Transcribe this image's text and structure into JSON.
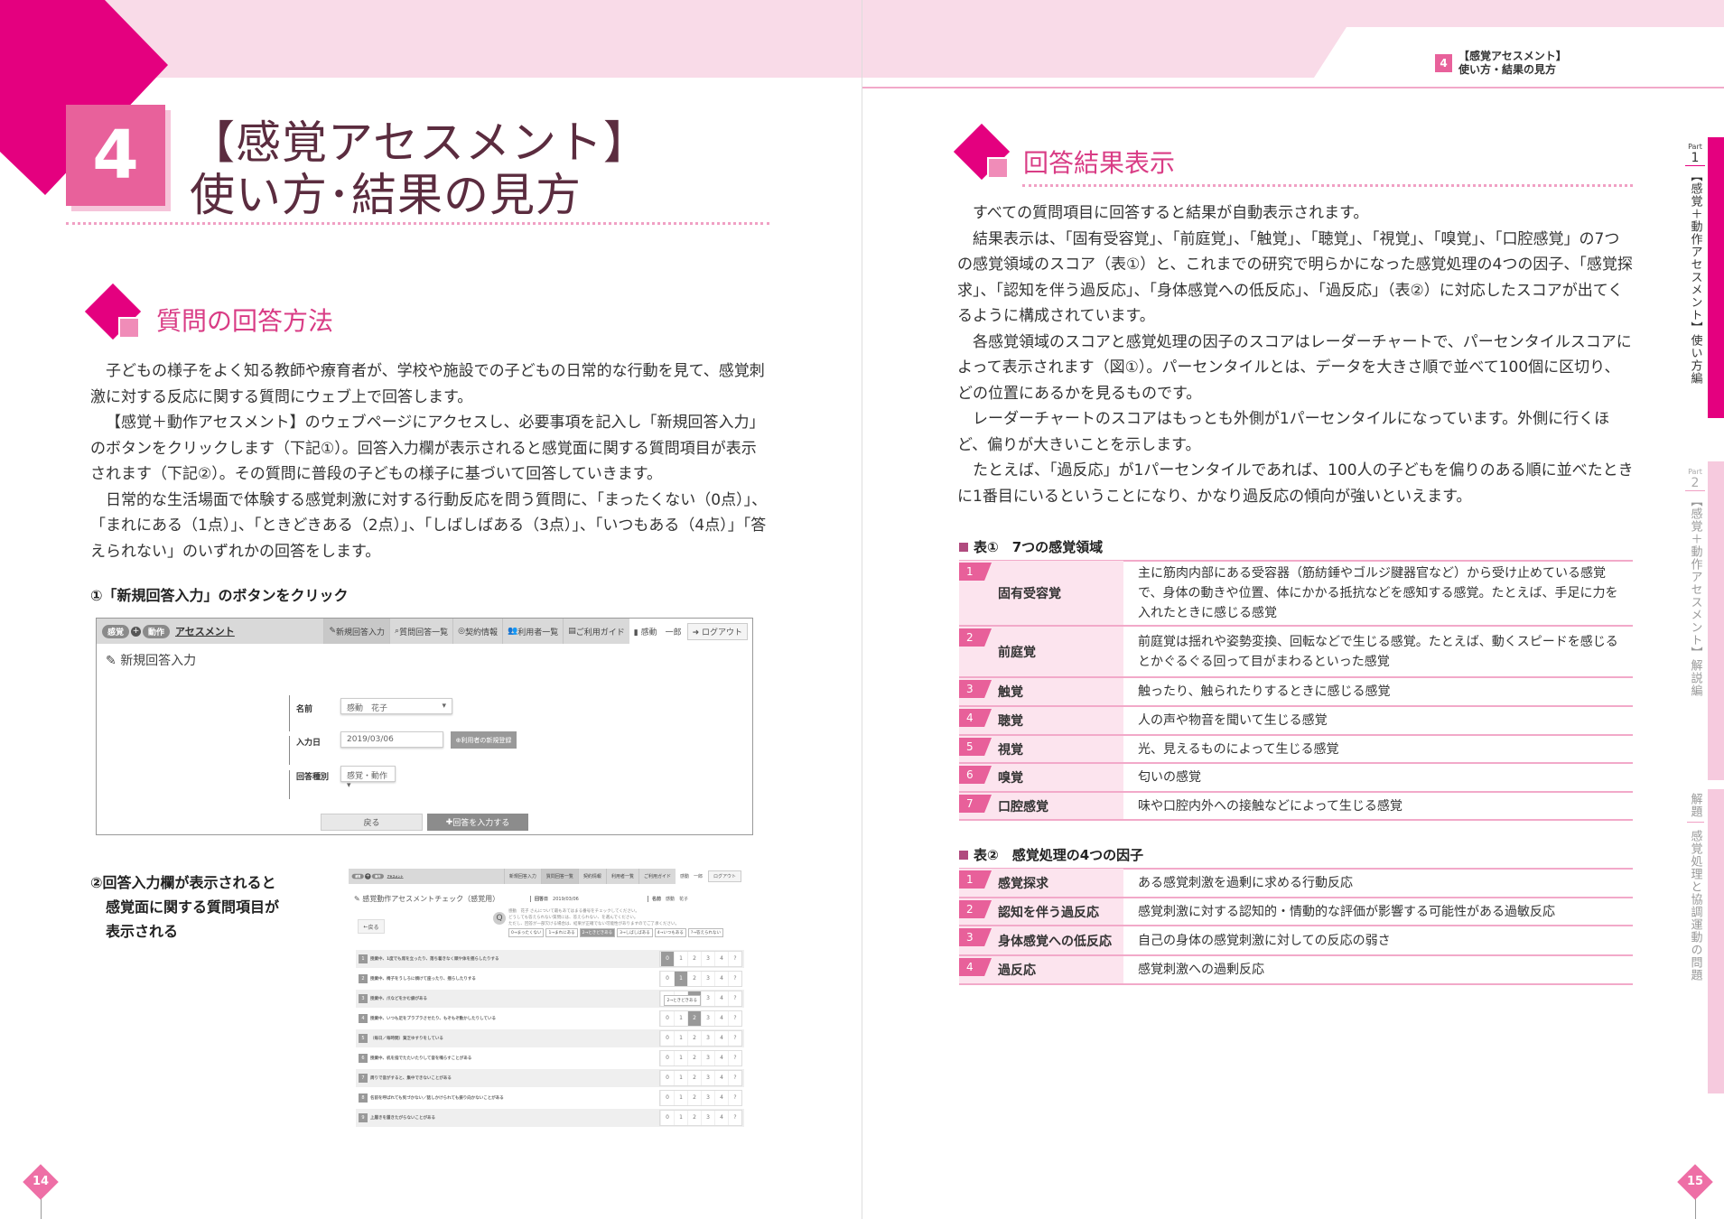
{
  "colors": {
    "accent": "#e4007f",
    "pink": "#e8619b",
    "band": "#f9dbe8",
    "title": "#5b2c3f"
  },
  "running_header": {
    "chapter_num": "4",
    "line1": "【感覚アセスメント】",
    "line2": "使い方・結果の見方"
  },
  "left": {
    "chapter_num": "4",
    "title_line1": "【感覚アセスメント】",
    "title_line2": "使い方･結果の見方",
    "section_title": "質問の回答方法",
    "paragraphs": [
      "子どもの様子をよく知る教師や療育者が、学校や施設での子どもの日常的な行動を見て、感覚刺激に対する反応に関する質問にウェブ上で回答します。",
      "【感覚＋動作アセスメント】のウェブページにアクセスし、必要事項を記入し「新規回答入力」のボタンをクリックします（下記①）。回答入力欄が表示されると感覚面に関する質問項目が表示されます（下記②）。その質問に普段の子どもの様子に基づいて回答していきます。",
      "日常的な生活場面で体験する感覚刺激に対する行動反応を問う質問に、「まったくない（0点）」、「まれにある（1点）」、「ときどきある（2点）」、「しばしばある（3点）」、「いつもある（4点）」「答えられない」のいずれかの回答をします。"
    ],
    "step1_label": "①「新規回答入力」のボタンをクリック",
    "step2_label": [
      "②回答入力欄が表示されると",
      "感覚面に関する質問項目が",
      "表示される"
    ],
    "page_number": "14"
  },
  "app": {
    "logo_sense": "感覚",
    "logo_plus": "+",
    "logo_motion": "動作",
    "logo_title": "アセスメント",
    "nav": [
      "新規回答入力",
      "質問回答一覧",
      "契約情報",
      "利用者一覧",
      "ご利用ガイド"
    ],
    "user": "感動　一郎",
    "logout": "ログアウト"
  },
  "screenshot1": {
    "page_title": "新規回答入力",
    "name_label": "名前",
    "name_value": "感動　花子",
    "date_label": "入力日",
    "date_value": "2019/03/06",
    "register_button": "利用者の新規登録",
    "type_label": "回答種別",
    "type_value": "感覚・動作",
    "back_button": "戻る",
    "submit_button": "回答を入力する"
  },
  "screenshot2": {
    "page_title": "感覚動作アセスメントチェック（感覚用）",
    "date_label": "回答日",
    "date_value": "2019/03/06",
    "name_label": "名前",
    "name_value": "感動　花子",
    "back_button": "戻る",
    "q_icon": "Q",
    "instructions": [
      "感動　花子 さんについて最もあてはまる番号をチェックしてください。",
      "どうしても答えられない質問には、答えられない、を選んでください。",
      "ただし、回答が一部欠ける場合は、結果が正確でない可能性がありますのでご了承ください。"
    ],
    "legend": [
      "0→まったくない",
      "1→まれにある",
      "2→ときどきある",
      "3→しばしばある",
      "4→いつもある",
      "?→答えられない"
    ],
    "legend_selected": 2,
    "choices": [
      "0",
      "1",
      "2",
      "3",
      "4",
      "?"
    ],
    "tooltip": "2→ときどきある",
    "questions": [
      {
        "num": "1",
        "text": "授業中、1度でも席を立ったり、落ち着きなく頭や体を揺らしたりする",
        "selected": 0
      },
      {
        "num": "2",
        "text": "授業中、椅子をうしろに傾けて座ったり、揺らしたりする",
        "selected": 1
      },
      {
        "num": "3",
        "text": "授業中、爪などをかむ癖がある",
        "selected": 2
      },
      {
        "num": "4",
        "text": "授業中、いつも足をブラブラさせたり、もぞもぞ動かしたりしている",
        "selected": 2
      },
      {
        "num": "5",
        "text": "（毎日／毎時間）貧乏ゆすりをしている",
        "selected": null
      },
      {
        "num": "6",
        "text": "授業中、机を指でたたいたりして音を鳴らすことがある",
        "selected": null
      },
      {
        "num": "7",
        "text": "周りで音がすると、集中できないことがある",
        "selected": null
      },
      {
        "num": "8",
        "text": "名前を呼ばれても気づかない／話しかけられても振り向かないことがある",
        "selected": null
      },
      {
        "num": "9",
        "text": "上履きを履きたがらないことがある",
        "selected": null
      }
    ]
  },
  "right": {
    "section_title": "回答結果表示",
    "paragraphs": [
      "すべての質問項目に回答すると結果が自動表示されます。",
      "結果表示は、「固有受容覚」、「前庭覚」、「触覚」、「聴覚」、「視覚」、「嗅覚」、「口腔感覚」の7つの感覚領域のスコア（表①）と、これまでの研究で明らかになった感覚処理の4つの因子、「感覚探求」、「認知を伴う過反応」、「身体感覚への低反応」、「過反応」（表②）に対応したスコアが出てくるように構成されています。",
      "各感覚領域のスコアと感覚処理の因子のスコアはレーダーチャートで、パーセンタイルスコアによって表示されます（図①）。パーセンタイルとは、データを大きさ順で並べて100個に区切り、どの位置にあるかを見るものです。",
      "レーダーチャートのスコアはもっとも外側が1パーセンタイルになっています。外側に行くほど、偏りが大きいことを示します。",
      "たとえば、「過反応」が1パーセンタイルであれば、100人の子どもを偏りのある順に並べたときに1番目にいるということになり、かなり過反応の傾向が強いといえます。"
    ],
    "table1": {
      "heading": "表①　7つの感覚領域",
      "rows": [
        {
          "num": "1",
          "label": "固有受容覚",
          "desc": "主に筋肉内部にある受容器（筋紡錘やゴルジ腱器官など）から受け止めている感覚で、身体の動きや位置、体にかかる抵抗などを感知する感覚。たとえば、手足に力を入れたときに感じる感覚"
        },
        {
          "num": "2",
          "label": "前庭覚",
          "desc": "前庭覚は揺れや姿勢変換、回転などで生じる感覚。たとえば、動くスピードを感じるとかぐるぐる回って目がまわるといった感覚"
        },
        {
          "num": "3",
          "label": "触覚",
          "desc": "触ったり、触られたりするときに感じる感覚"
        },
        {
          "num": "4",
          "label": "聴覚",
          "desc": "人の声や物音を聞いて生じる感覚"
        },
        {
          "num": "5",
          "label": "視覚",
          "desc": "光、見えるものによって生じる感覚"
        },
        {
          "num": "6",
          "label": "嗅覚",
          "desc": "匂いの感覚"
        },
        {
          "num": "7",
          "label": "口腔感覚",
          "desc": "味や口腔内外への接触などによって生じる感覚"
        }
      ]
    },
    "table2": {
      "heading": "表②　感覚処理の4つの因子",
      "rows": [
        {
          "num": "1",
          "label": "感覚探求",
          "desc": "ある感覚刺激を過剰に求める行動反応"
        },
        {
          "num": "2",
          "label": "認知を伴う過反応",
          "desc": "感覚刺激に対する認知的・情動的な評価が影響する可能性がある過敏反応"
        },
        {
          "num": "3",
          "label": "身体感覚への低反応",
          "desc": "自己の身体の感覚刺激に対しての反応の弱さ"
        },
        {
          "num": "4",
          "label": "過反応",
          "desc": "感覚刺激への過剰反応"
        }
      ]
    },
    "page_number": "15"
  },
  "side_tabs": [
    {
      "part_label": "Part",
      "part_num": "1",
      "title": "【感覚＋動作アセスメント】使い方編",
      "active": true
    },
    {
      "part_label": "Part",
      "part_num": "2",
      "title": "【感覚＋動作アセスメント】解説編",
      "active": false
    },
    {
      "part_label": "解題",
      "part_num": "",
      "title": "感覚処理と協調運動の問題",
      "active": false
    }
  ]
}
